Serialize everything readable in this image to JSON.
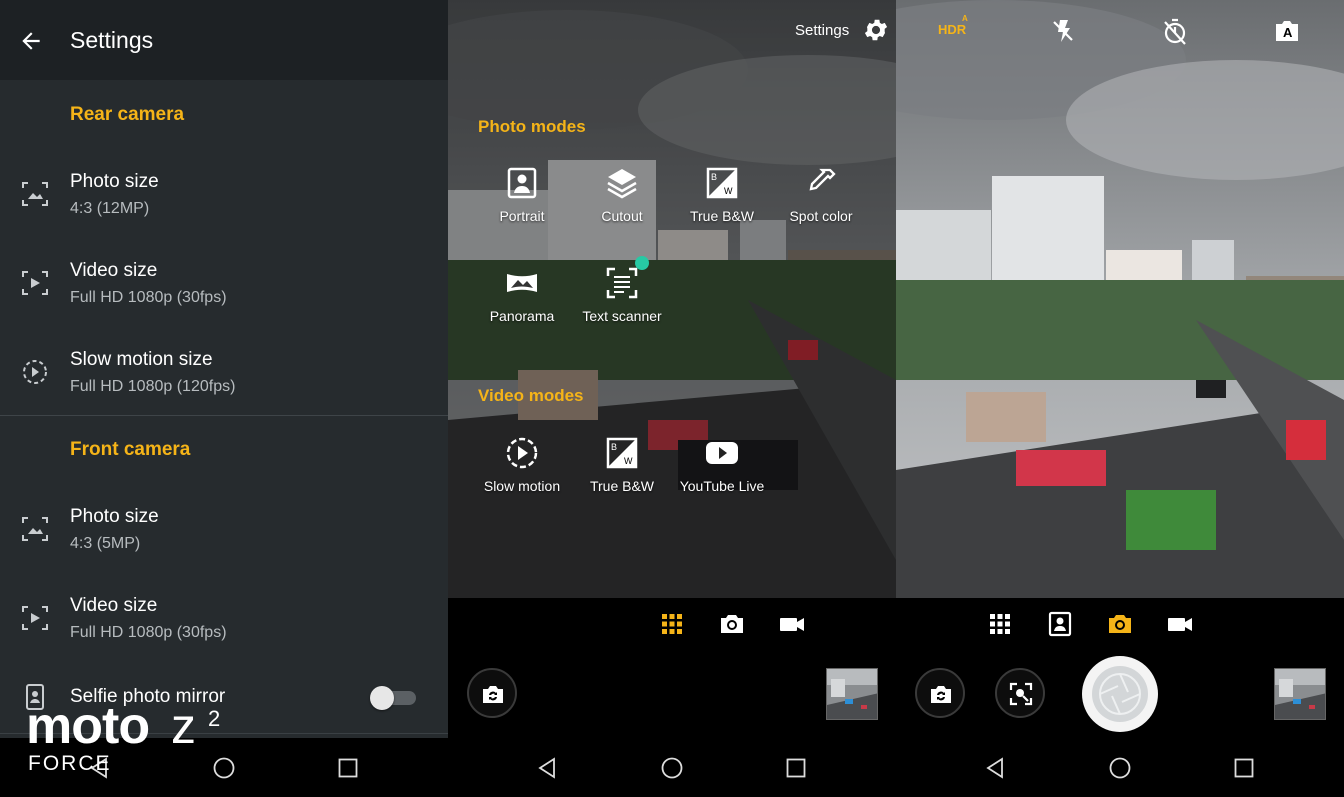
{
  "settings": {
    "title": "Settings",
    "rear_section": "Rear camera",
    "front_section": "Front camera",
    "rear": [
      {
        "label": "Photo size",
        "value": "4:3 (12MP)",
        "icon": "photo-size-icon"
      },
      {
        "label": "Video size",
        "value": "Full HD 1080p (30fps)",
        "icon": "video-size-icon"
      },
      {
        "label": "Slow motion size",
        "value": "Full HD 1080p (120fps)",
        "icon": "slow-motion-icon"
      }
    ],
    "front": [
      {
        "label": "Photo size",
        "value": "4:3 (5MP)",
        "icon": "photo-size-icon"
      },
      {
        "label": "Video size",
        "value": "Full HD 1080p (30fps)",
        "icon": "video-size-icon"
      },
      {
        "label": "Selfie photo mirror",
        "value": "",
        "icon": "selfie-mirror-icon",
        "toggle_on": false
      }
    ]
  },
  "branding": {
    "moto": "moto",
    "z": "z",
    "sup": "2",
    "force": "FORCE"
  },
  "modes": {
    "settings_label": "Settings",
    "photo_heading": "Photo modes",
    "video_heading": "Video modes",
    "photo": [
      {
        "label": "Portrait",
        "icon": "portrait-icon"
      },
      {
        "label": "Cutout",
        "icon": "cutout-icon"
      },
      {
        "label": "True B&W",
        "icon": "true-bw-icon"
      },
      {
        "label": "Spot color",
        "icon": "spot-color-icon"
      },
      {
        "label": "Panorama",
        "icon": "panorama-icon"
      },
      {
        "label": "Text scanner",
        "icon": "text-scanner-icon"
      }
    ],
    "video": [
      {
        "label": "Slow motion",
        "icon": "slow-motion-icon"
      },
      {
        "label": "True B&W",
        "icon": "true-bw-icon"
      },
      {
        "label": "YouTube Live",
        "icon": "youtube-icon"
      }
    ]
  },
  "viewfinder": {
    "hdr": "HDR",
    "hdr_badge": "A",
    "auto_badge": "A"
  },
  "colors": {
    "accent": "#f5b418",
    "panel_bg": "#262b2e",
    "header_bg": "#1d2124",
    "new_dot": "#27c9a4"
  }
}
